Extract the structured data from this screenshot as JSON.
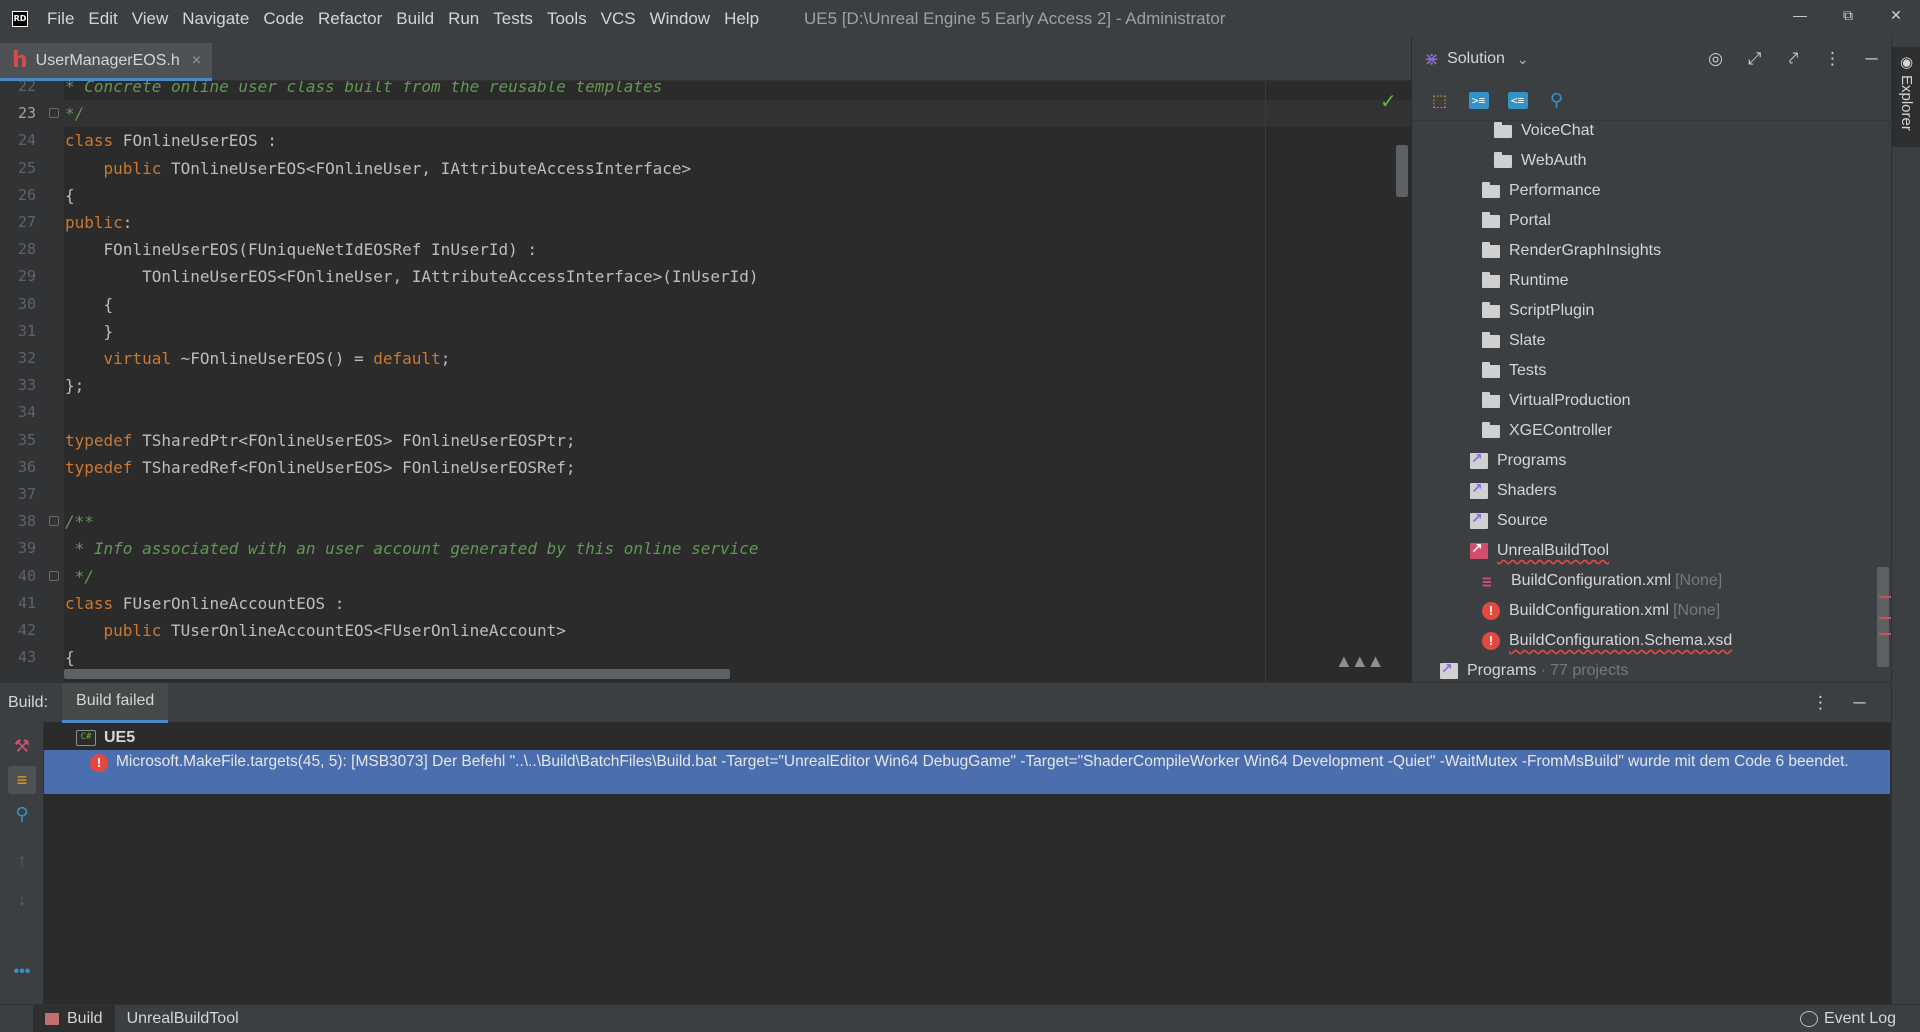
{
  "app": {
    "title": "UE5 [D:\\Unreal Engine 5 Early Access 2] - Administrator",
    "logo_text": "RD"
  },
  "menu": [
    "File",
    "Edit",
    "View",
    "Navigate",
    "Code",
    "Refactor",
    "Build",
    "Run",
    "Tests",
    "Tools",
    "VCS",
    "Window",
    "Help"
  ],
  "editor": {
    "tab": {
      "label": "UserManagerEOS.h",
      "close": "×"
    },
    "lines": [
      {
        "n": "22",
        "html": "<span class=\"cm\">* Concrete online user class built from the reusable templates</span>"
      },
      {
        "n": "23",
        "html": "<span class=\"cm\">*/</span>",
        "current": true,
        "fold": true
      },
      {
        "n": "24",
        "html": "<span class=\"kw\">class</span> FOnlineUserEOS :"
      },
      {
        "n": "25",
        "html": "    <span class=\"kw\">public</span> TOnlineUserEOS&lt;FOnlineUser, IAttributeAccessInterface&gt;"
      },
      {
        "n": "26",
        "html": "{"
      },
      {
        "n": "27",
        "html": "<span class=\"kw\">public</span>:"
      },
      {
        "n": "28",
        "html": "    FOnlineUserEOS(FUniqueNetIdEOSRef InUserId) :"
      },
      {
        "n": "29",
        "html": "        TOnlineUserEOS&lt;FOnlineUser, IAttributeAccessInterface&gt;(InUserId)"
      },
      {
        "n": "30",
        "html": "    {"
      },
      {
        "n": "31",
        "html": "    }"
      },
      {
        "n": "32",
        "html": "    <span class=\"kw\">virtual</span> ~FOnlineUserEOS() = <span class=\"kw\">default</span>;"
      },
      {
        "n": "33",
        "html": "};"
      },
      {
        "n": "34",
        "html": ""
      },
      {
        "n": "35",
        "html": "<span class=\"kw\">typedef</span> TSharedPtr&lt;FOnlineUserEOS&gt; FOnlineUserEOSPtr;"
      },
      {
        "n": "36",
        "html": "<span class=\"kw\">typedef</span> TSharedRef&lt;FOnlineUserEOS&gt; FOnlineUserEOSRef;"
      },
      {
        "n": "37",
        "html": ""
      },
      {
        "n": "38",
        "html": "<span class=\"cm\">/**</span>",
        "fold": true
      },
      {
        "n": "39",
        "html": "<span class=\"cm\"> * Info associated with an user account generated by this online service</span>"
      },
      {
        "n": "40",
        "html": "<span class=\"cm\"> */</span>",
        "fold": true
      },
      {
        "n": "41",
        "html": "<span class=\"kw\">class</span> FUserOnlineAccountEOS :"
      },
      {
        "n": "42",
        "html": "    <span class=\"kw\">public</span> TUserOnlineAccountEOS&lt;FUserOnlineAccount&gt;"
      },
      {
        "n": "43",
        "html": "{"
      }
    ]
  },
  "solution": {
    "title": "Solution",
    "tree": [
      {
        "label": "VoiceChat",
        "icon": "folder",
        "indent": 2
      },
      {
        "label": "WebAuth",
        "icon": "folder",
        "indent": 2
      },
      {
        "label": "Performance",
        "icon": "folder",
        "indent": 1
      },
      {
        "label": "Portal",
        "icon": "folder",
        "indent": 1
      },
      {
        "label": "RenderGraphInsights",
        "icon": "folder",
        "indent": 1
      },
      {
        "label": "Runtime",
        "icon": "folder",
        "indent": 1
      },
      {
        "label": "ScriptPlugin",
        "icon": "folder",
        "indent": 1
      },
      {
        "label": "Slate",
        "icon": "folder",
        "indent": 1
      },
      {
        "label": "Tests",
        "icon": "folder",
        "indent": 1
      },
      {
        "label": "VirtualProduction",
        "icon": "folder",
        "indent": 1
      },
      {
        "label": "XGEController",
        "icon": "folder",
        "indent": 1
      },
      {
        "label": "Programs",
        "icon": "project",
        "indent": 0
      },
      {
        "label": "Shaders",
        "icon": "project",
        "indent": 0
      },
      {
        "label": "Source",
        "icon": "project",
        "indent": 0
      },
      {
        "label": "UnrealBuildTool",
        "icon": "project-error",
        "indent": 0,
        "error": true
      },
      {
        "label": "BuildConfiguration.xml",
        "suffix": "[None]",
        "icon": "xml",
        "indent": 1
      },
      {
        "label": "BuildConfiguration.xml",
        "suffix": "[None]",
        "icon": "error",
        "indent": 1
      },
      {
        "label": "BuildConfiguration.Schema.xsd",
        "icon": "error",
        "indent": 1,
        "error": true
      },
      {
        "label": "Programs",
        "suffix": "· 77 projects",
        "icon": "project",
        "indent": -1
      }
    ]
  },
  "right_strip": {
    "label": "Explorer"
  },
  "build": {
    "caption": "Build:",
    "tab": "Build failed",
    "root": "UE5",
    "error_message": "Microsoft.MakeFile.targets(45, 5): [MSB3073] Der Befehl \"..\\..\\Build\\BatchFiles\\Build.bat -Target=\"UnrealEditor Win64 DebugGame\" -Target=\"ShaderCompileWorker Win64 Development -Quiet\" -WaitMutex -FromMsBuild\" wurde mit dem Code 6 beendet."
  },
  "status_bar": {
    "tabs": [
      "Build",
      "UnrealBuildTool"
    ],
    "event_log": "Event Log"
  },
  "colors": {
    "accent": "#4a88c7",
    "selection": "#4b6eaf",
    "error": "#e5483f",
    "keyword": "#cc7832",
    "comment": "#629755"
  }
}
